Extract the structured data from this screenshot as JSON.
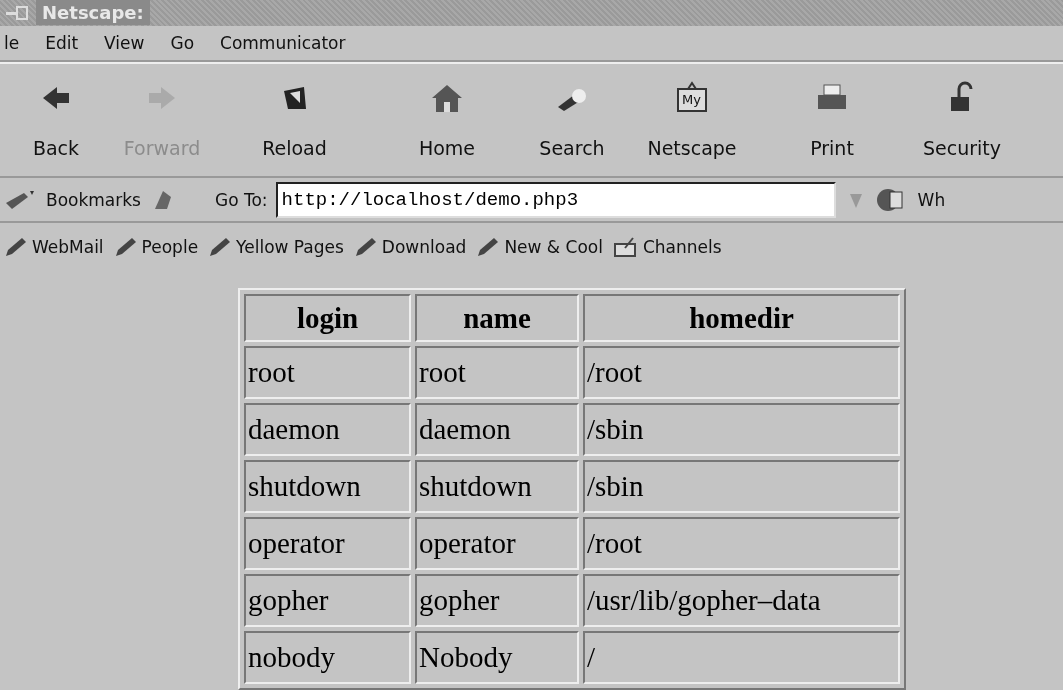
{
  "window": {
    "title": "Netscape:"
  },
  "menu": [
    "le",
    "Edit",
    "View",
    "Go",
    "Communicator"
  ],
  "toolbar": [
    {
      "label": "Back",
      "kind": "back",
      "disabled": false
    },
    {
      "label": "Forward",
      "kind": "forward",
      "disabled": true
    },
    {
      "label": "Reload",
      "kind": "reload",
      "disabled": false
    },
    {
      "label": "Home",
      "kind": "home",
      "disabled": false
    },
    {
      "label": "Search",
      "kind": "search",
      "disabled": false
    },
    {
      "label": "Netscape",
      "kind": "netscape",
      "disabled": false,
      "badge": "My"
    },
    {
      "label": "Print",
      "kind": "print",
      "disabled": false
    },
    {
      "label": "Security",
      "kind": "security",
      "disabled": false
    }
  ],
  "location": {
    "bookmarks": "Bookmarks",
    "goto_label": "Go To:",
    "url": "http://localhost/demo.php3",
    "whats_related": "Wh"
  },
  "personal_toolbar": [
    {
      "label": "WebMail",
      "kind": "link"
    },
    {
      "label": "People",
      "kind": "link"
    },
    {
      "label": "Yellow Pages",
      "kind": "link"
    },
    {
      "label": "Download",
      "kind": "link"
    },
    {
      "label": "New & Cool",
      "kind": "link"
    },
    {
      "label": "Channels",
      "kind": "channels"
    }
  ],
  "table": {
    "columns": [
      "login",
      "name",
      "homedir"
    ],
    "rows": [
      [
        "root",
        "root",
        "/root"
      ],
      [
        "daemon",
        "daemon",
        "/sbin"
      ],
      [
        "shutdown",
        "shutdown",
        "/sbin"
      ],
      [
        "operator",
        "operator",
        "/root"
      ],
      [
        "gopher",
        "gopher",
        "/usr/lib/gopher–data"
      ],
      [
        "nobody",
        "Nobody",
        "/"
      ]
    ]
  }
}
